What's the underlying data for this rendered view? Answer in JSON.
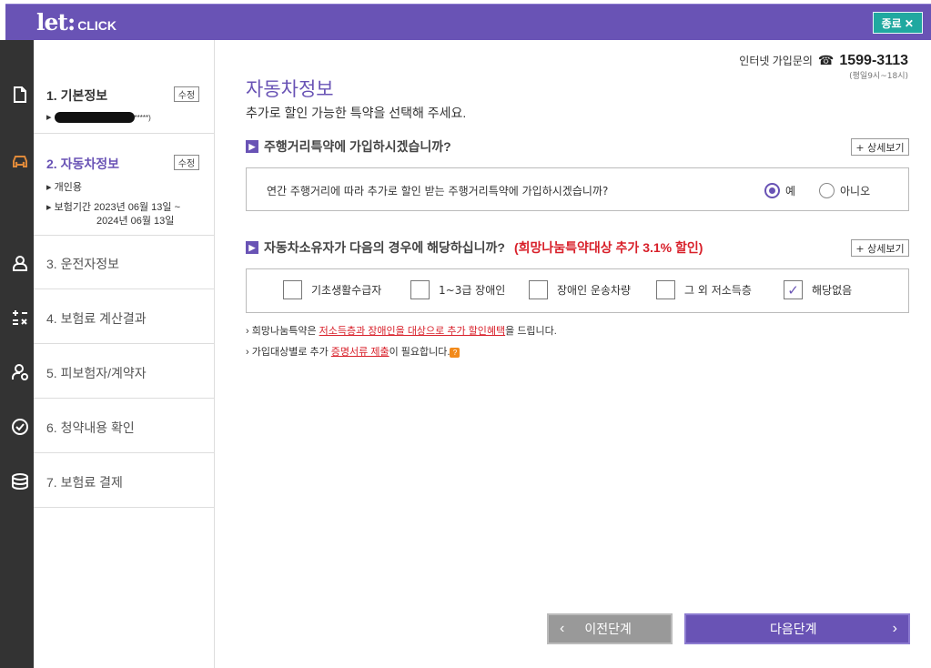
{
  "header": {
    "logo_main": "let:",
    "logo_sub": "CLICK",
    "close_label": "종료 ✕"
  },
  "sidebar": {
    "steps": [
      {
        "title": "1. 기본정보",
        "edit": "수정",
        "sub1": "▸"
      },
      {
        "title": "2. 자동차정보",
        "edit": "수정",
        "sub1": "▸ 개인용",
        "sub2": "▸ 보험기간 2023년 06월 13일 ~",
        "sub3": "2024년 06월 13일"
      },
      {
        "title": "3. 운전자정보"
      },
      {
        "title": "4. 보험료 계산결과"
      },
      {
        "title": "5. 피보험자/계약자"
      },
      {
        "title": "6. 청약내용 확인"
      },
      {
        "title": "7. 보험료 결제"
      }
    ],
    "redacted_suffix": "*****)"
  },
  "contact": {
    "label": "인터넷 가입문의",
    "phone": "1599-3113",
    "hours": "(평일9시~18시)"
  },
  "main": {
    "title": "자동차정보",
    "subtitle": "추가로 할인 가능한 특약을 선택해 주세요.",
    "section1": {
      "heading": "주행거리특약에 가입하시겠습니까?",
      "detail": "+ 상세보기",
      "question": "연간 주행거리에 따라 추가로 할인 받는 주행거리특약에 가입하시겠습니까?",
      "yes": "예",
      "no": "아니오",
      "selected": "yes"
    },
    "section2": {
      "heading": "자동차소유자가 다음의 경우에 해당하십니까?",
      "heading_red": "(희망나눔특약대상 추가 3.1% 할인)",
      "detail": "+ 상세보기",
      "options": [
        {
          "label": "기초생활수급자",
          "checked": false
        },
        {
          "label": "1~3급 장애인",
          "checked": false
        },
        {
          "label": "장애인 운송차량",
          "checked": false
        },
        {
          "label": "그 외 저소득층",
          "checked": false
        },
        {
          "label": "해당없음",
          "checked": true
        }
      ]
    },
    "notes": {
      "n1_a": "› 희망나눔특약은 ",
      "n1_link": "저소득층과 장애인을 대상으로 추가 할인혜택",
      "n1_b": "을 드립니다.",
      "n2_a": "› 가입대상별로 추가 ",
      "n2_link": "증명서류 제출",
      "n2_b": "이 필요합니다.",
      "n2_badge": "?"
    },
    "prev_label": "이전단계",
    "next_label": "다음단계"
  }
}
